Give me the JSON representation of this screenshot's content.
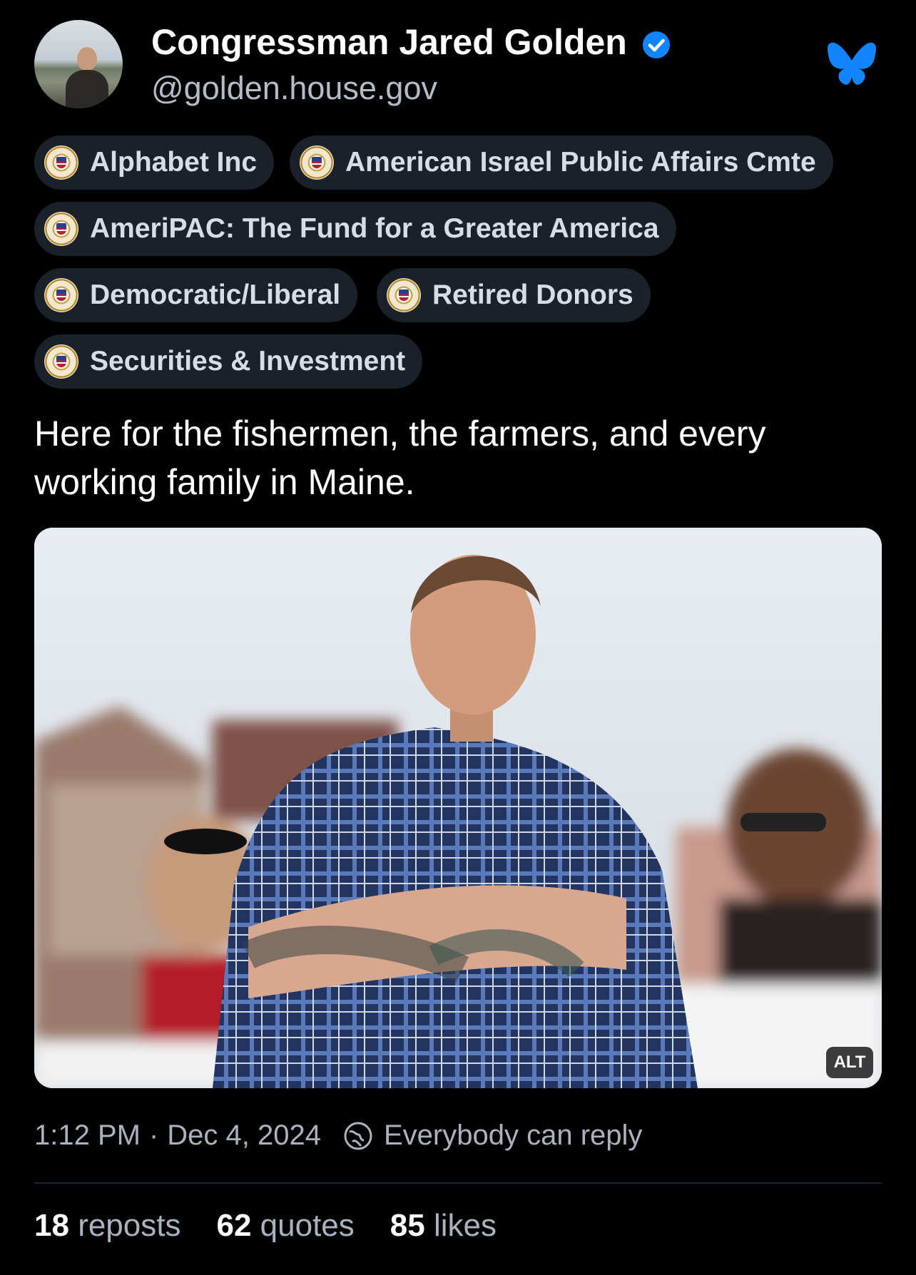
{
  "header": {
    "display_name": "Congressman Jared Golden",
    "handle": "@golden.house.gov",
    "verified_icon": "verified-check-icon",
    "app_icon": "bluesky-butterfly-icon",
    "accent_color": "#1185fe"
  },
  "labels": [
    {
      "text": "Alphabet Inc",
      "icon": "us-seal-icon"
    },
    {
      "text": "American Israel Public Affairs Cmte",
      "icon": "us-seal-icon"
    },
    {
      "text": "AmeriPAC: The Fund for a Greater America",
      "icon": "us-seal-icon"
    },
    {
      "text": "Democratic/Liberal",
      "icon": "us-seal-icon"
    },
    {
      "text": "Retired Donors",
      "icon": "us-seal-icon"
    },
    {
      "text": "Securities & Investment",
      "icon": "us-seal-icon"
    }
  ],
  "post": {
    "text": "Here for the fishermen, the farmers, and every working family in Maine.",
    "image_alt_badge": "ALT"
  },
  "meta": {
    "time": "1:12 PM",
    "separator": "·",
    "date": "Dec 4, 2024",
    "reply_setting": "Everybody can reply"
  },
  "stats": {
    "reposts_count": "18",
    "reposts_label": "reposts",
    "quotes_count": "62",
    "quotes_label": "quotes",
    "likes_count": "85",
    "likes_label": "likes"
  }
}
